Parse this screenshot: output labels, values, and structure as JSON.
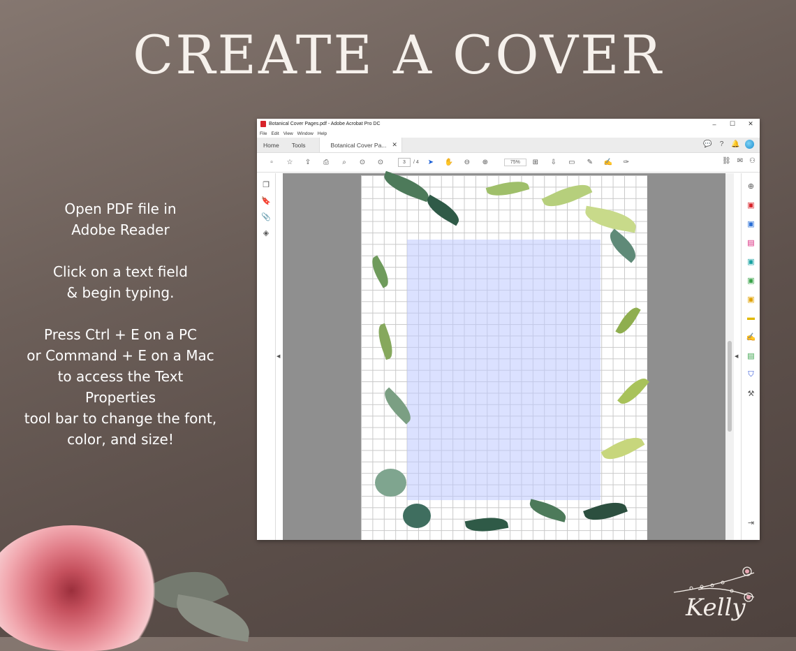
{
  "headline": "CREATE A COVER",
  "instructions": {
    "p1": [
      "Open PDF file in",
      "Adobe Reader"
    ],
    "p2": [
      "Click on a text field",
      "& begin typing."
    ],
    "p3": [
      "Press Ctrl + E on a PC",
      "or Command + E on a Mac",
      "to access the Text Properties",
      "tool bar to change the font,",
      "color, and size!"
    ]
  },
  "window": {
    "title": "Botanical Cover Pages.pdf - Adobe Acrobat Pro DC",
    "controls": [
      "–",
      "☐",
      "✕"
    ],
    "menu": [
      "File",
      "Edit",
      "View",
      "Window",
      "Help"
    ],
    "tabs": {
      "home": "Home",
      "tools": "Tools",
      "doc": "Botanical Cover Pa...",
      "close": "✕"
    },
    "current_page": "3",
    "page_sep": "/ 4",
    "zoom": "75%",
    "accent": "#d8232a"
  },
  "signature": "Kelly"
}
